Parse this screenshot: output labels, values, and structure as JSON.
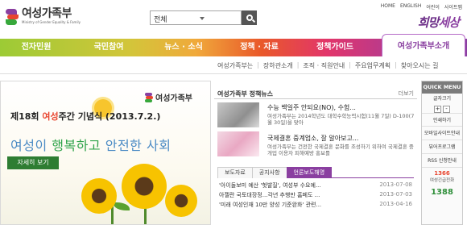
{
  "logo": {
    "name": "여성가족부",
    "subtitle": "Ministry of Gender Equality & Family"
  },
  "search": {
    "scope": "전체"
  },
  "util_links": [
    "HOME",
    "ENGLISH",
    "어린이",
    "사이트맵"
  ],
  "slogan": {
    "part1": "희망",
    "part2": "세상"
  },
  "nav": {
    "items": [
      "전자민원",
      "국민참여",
      "뉴스 · 소식",
      "정책 · 자료",
      "정책가이드",
      "여성가족부소개"
    ],
    "active_index": 5
  },
  "subnav": {
    "items": [
      "여성가족부는",
      "장하관소개",
      "조직 · 직원안내",
      "주요업무계획",
      "찾아오시는 길"
    ]
  },
  "banner": {
    "logo_text": "여성가족부",
    "title_prefix": "제18회 ",
    "title_highlight": "여성",
    "title_suffix": "주간 기념식 (2013.7.2.)",
    "tagline_part1": "여성이 ",
    "tagline_part2": "행복하고",
    "tagline_part3": " 안전한 사회",
    "more_label": "자세히 보기"
  },
  "news": {
    "heading": "여성가족부 정책뉴스",
    "more": "더보기",
    "items": [
      {
        "title": "수능 백일주 안되요(NO), 수험...",
        "desc": "여성가족부는 2014학년도 대학수학능력시험(11월 7일) D-100(7월 30일)을 맞아"
      },
      {
        "title": "국제결혼 중계업소, 잘 알아보고...",
        "desc": "여성가족부는 건전한 국제결혼 문화를 조성하기 위하여 국제결혼 중개업 이용자 피해예방 홍보를"
      }
    ],
    "tabs": [
      "보도자료",
      "공지사항",
      "언론보도해명"
    ],
    "active_tab": 2,
    "list": [
      {
        "text": "'아이돌보미 예산 '헛발질', 여성부 수요예...",
        "date": "2013-07-08"
      },
      {
        "text": "아젤란 국토대장정...각년 추행만 홈페도 ...",
        "date": "2013-07-03"
      },
      {
        "text": "'미래 여성인재 10만 양성 기준완화' 관련...",
        "date": "2013-04-16"
      }
    ]
  },
  "quick_menu": {
    "title": "QUICK MENU",
    "font_size_label": "글자크기",
    "font_buttons": [
      "+",
      "-"
    ],
    "items": [
      "인쇄하기",
      "모바일사이트안내",
      "뷰어프로그램",
      "RSS 신청안내"
    ],
    "hotline_number": "1366",
    "hotline_label": "여성긴급전화",
    "youth_number": "1388"
  },
  "colors": {
    "brand": "#8a3fa0",
    "accent_red": "#e8452f",
    "accent_green": "#37a83b"
  }
}
